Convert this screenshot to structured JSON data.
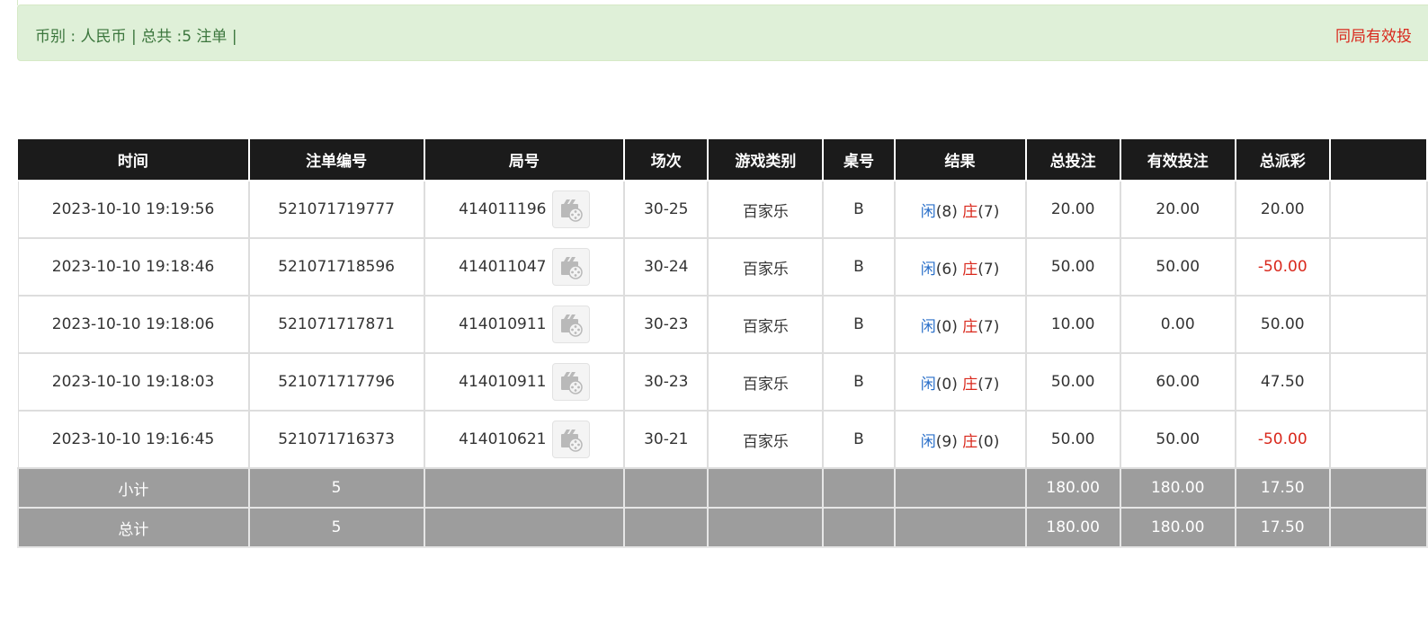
{
  "summary": {
    "text": "币别 : 人民币 | 总共 :5 注单 |",
    "note": "同局有效投"
  },
  "table": {
    "headers": [
      "时间",
      "注单编号",
      "局号",
      "场次",
      "游戏类别",
      "桌号",
      "结果",
      "总投注",
      "有效投注",
      "总派彩",
      ""
    ],
    "rows": [
      {
        "time": "2023-10-10 19:19:56",
        "bet_id": "521071719777",
        "round": "414011196",
        "session": "30-25",
        "game": "百家乐",
        "table": "B",
        "player_label": "闲",
        "player_score": "(8)",
        "banker_label": "庄",
        "banker_score": "(7)",
        "total_bet": "20.00",
        "valid_bet": "20.00",
        "payout": "20.00",
        "payout_color": "#333333"
      },
      {
        "time": "2023-10-10 19:18:46",
        "bet_id": "521071718596",
        "round": "414011047",
        "session": "30-24",
        "game": "百家乐",
        "table": "B",
        "player_label": "闲",
        "player_score": "(6)",
        "banker_label": "庄",
        "banker_score": "(7)",
        "total_bet": "50.00",
        "valid_bet": "50.00",
        "payout": "-50.00",
        "payout_color": "#d9281c"
      },
      {
        "time": "2023-10-10 19:18:06",
        "bet_id": "521071717871",
        "round": "414010911",
        "session": "30-23",
        "game": "百家乐",
        "table": "B",
        "player_label": "闲",
        "player_score": "(0)",
        "banker_label": "庄",
        "banker_score": "(7)",
        "total_bet": "10.00",
        "valid_bet": "0.00",
        "payout": "50.00",
        "payout_color": "#333333"
      },
      {
        "time": "2023-10-10 19:18:03",
        "bet_id": "521071717796",
        "round": "414010911",
        "session": "30-23",
        "game": "百家乐",
        "table": "B",
        "player_label": "闲",
        "player_score": "(0)",
        "banker_label": "庄",
        "banker_score": "(7)",
        "total_bet": "50.00",
        "valid_bet": "60.00",
        "payout": "47.50",
        "payout_color": "#333333"
      },
      {
        "time": "2023-10-10 19:16:45",
        "bet_id": "521071716373",
        "round": "414010621",
        "session": "30-21",
        "game": "百家乐",
        "table": "B",
        "player_label": "闲",
        "player_score": "(9)",
        "banker_label": "庄",
        "banker_score": "(0)",
        "total_bet": "50.00",
        "valid_bet": "50.00",
        "payout": "-50.00",
        "payout_color": "#d9281c"
      }
    ],
    "subtotal": {
      "label": "小计",
      "count": "5",
      "total_bet": "180.00",
      "valid_bet": "180.00",
      "payout": "17.50"
    },
    "grand_total": {
      "label": "总计",
      "count": "5",
      "total_bet": "180.00",
      "valid_bet": "180.00",
      "payout": "17.50"
    }
  },
  "icons": {
    "replay": "video-replay-icon"
  },
  "colors": {
    "header_bg": "#1b1b1b",
    "footer_bg": "#9d9d9d",
    "alert_bg": "#dff0d8",
    "alert_text": "#3c763d",
    "blue": "#2a6fc9",
    "red": "#d9281c"
  }
}
